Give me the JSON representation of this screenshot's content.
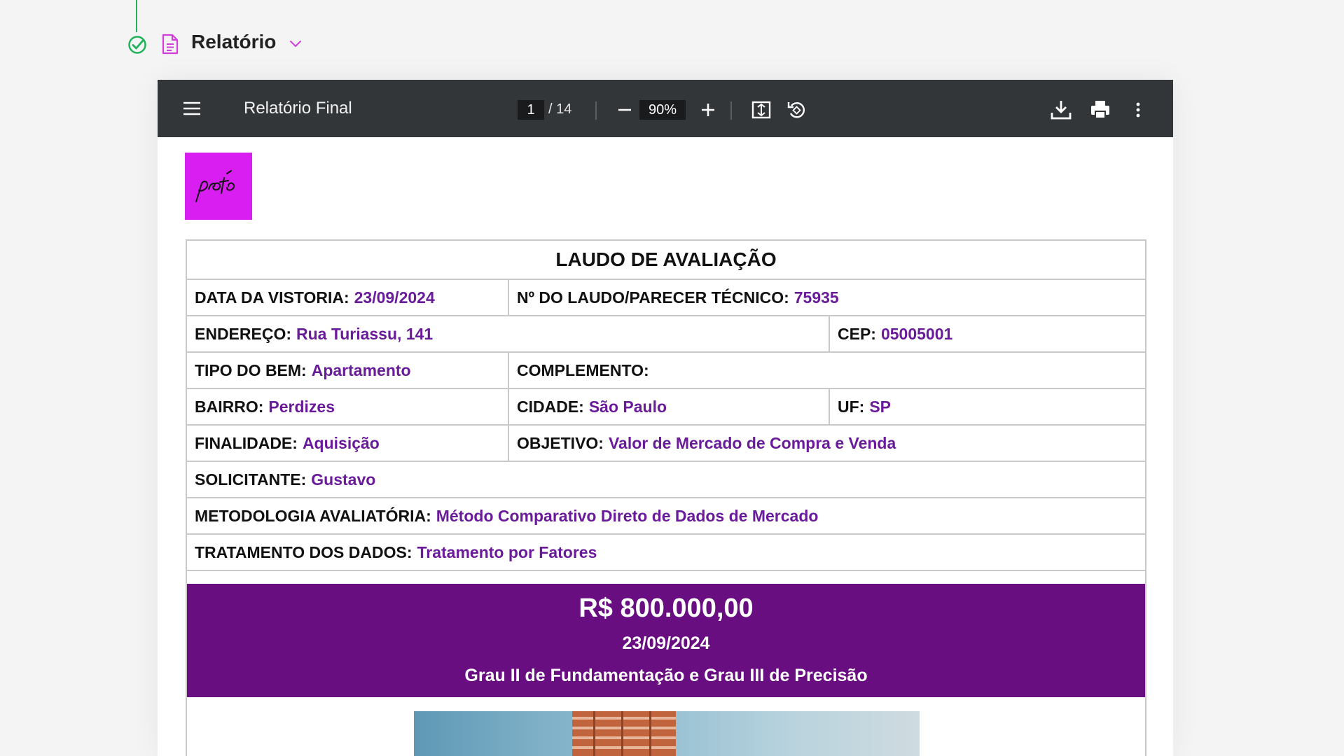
{
  "section": {
    "title": "Relatório",
    "icons": {
      "status": "check-circle-icon",
      "document": "document-icon",
      "toggle": "chevron-down-icon"
    }
  },
  "viewer": {
    "title": "Relatório Final",
    "page_current": "1",
    "page_total": "/ 14",
    "zoom": "90%",
    "icons": {
      "menu": "menu-icon",
      "zoom_out": "minus-icon",
      "zoom_in": "plus-icon",
      "fit": "fit-page-icon",
      "rotate": "rotate-icon",
      "download": "download-icon",
      "print": "print-icon",
      "more": "more-vertical-icon"
    }
  },
  "document": {
    "logo_text": "proto",
    "heading": "LAUDO DE AVALIAÇÃO",
    "fields": {
      "data_vistoria": {
        "label": "DATA DA VISTORIA:",
        "value": "23/09/2024"
      },
      "numero_laudo": {
        "label": "Nº DO LAUDO/PARECER TÉCNICO:",
        "value": "75935"
      },
      "endereco": {
        "label": "ENDEREÇO:",
        "value": "Rua Turiassu, 141"
      },
      "cep": {
        "label": "CEP:",
        "value": "05005001"
      },
      "tipo_bem": {
        "label": "TIPO DO BEM:",
        "value": "Apartamento"
      },
      "complemento": {
        "label": "COMPLEMENTO:",
        "value": ""
      },
      "bairro": {
        "label": "BAIRRO:",
        "value": "Perdizes"
      },
      "cidade": {
        "label": "CIDADE:",
        "value": "São Paulo"
      },
      "uf": {
        "label": "UF:",
        "value": "SP"
      },
      "finalidade": {
        "label": "FINALIDADE:",
        "value": "Aquisição"
      },
      "objetivo": {
        "label": "OBJETIVO:",
        "value": "Valor de Mercado de Compra e Venda"
      },
      "solicitante": {
        "label": "SOLICITANTE:",
        "value": "Gustavo"
      },
      "metodologia": {
        "label": "METODOLOGIA AVALIATÓRIA:",
        "value": "Método Comparativo Direto de Dados de Mercado"
      },
      "tratamento": {
        "label": "TRATAMENTO DOS DADOS:",
        "value": "Tratamento por Fatores"
      }
    },
    "result": {
      "value": "R$ 800.000,00",
      "date": "23/09/2024",
      "grade": "Grau II de Fundamentação e Grau III de Precisão"
    }
  },
  "colors": {
    "accent_purple": "#680e80",
    "value_text": "#6a1b9a",
    "logo_bg": "#d81ef0",
    "toolbar_bg": "#323639",
    "status_green": "#1fb45a",
    "doc_icon": "#d13fd9"
  }
}
